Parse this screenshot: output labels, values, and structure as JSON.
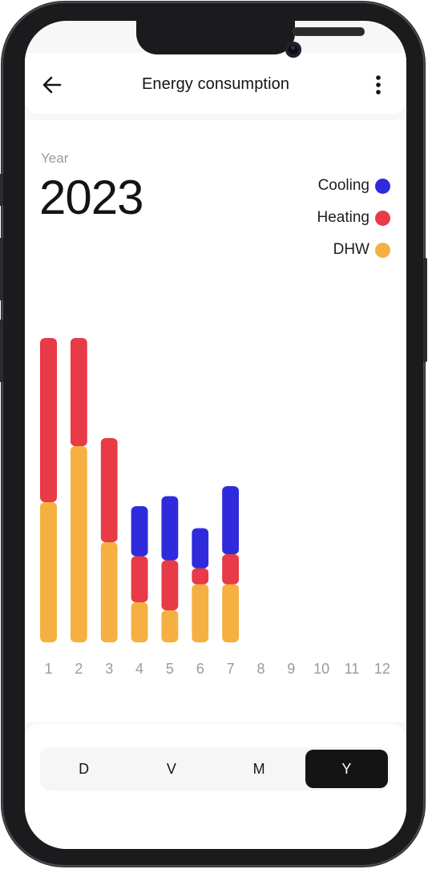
{
  "header": {
    "title": "Energy consumption",
    "back_icon": "arrow-left-icon",
    "more_icon": "more-vertical-icon"
  },
  "period": {
    "label": "Year",
    "value": "2023"
  },
  "colors": {
    "cooling": "#2f2bdc",
    "heating": "#e83a47",
    "dhw": "#f5b041",
    "tick": "#9a9a9a"
  },
  "chart_data": {
    "type": "bar",
    "stacked": true,
    "categories": [
      "1",
      "2",
      "3",
      "4",
      "5",
      "6",
      "7",
      "8",
      "9",
      "10",
      "11",
      "12"
    ],
    "series": [
      {
        "name": "DHW",
        "values": [
          35,
          49,
          25,
          10,
          8,
          14.5,
          14.5,
          0,
          0,
          0,
          0,
          0
        ]
      },
      {
        "name": "Heating",
        "values": [
          41,
          27,
          26,
          11.5,
          12.5,
          4,
          7.5,
          0,
          0,
          0,
          0,
          0
        ]
      },
      {
        "name": "Cooling",
        "values": [
          0,
          0,
          0,
          12.5,
          16,
          10,
          17,
          0,
          0,
          0,
          0,
          0
        ]
      }
    ],
    "ylim": [
      0,
      76
    ],
    "grid": false,
    "legend_position": "top-right",
    "legend_order": [
      "Cooling",
      "Heating",
      "DHW"
    ]
  },
  "view_selector": {
    "options": [
      "D",
      "V",
      "M",
      "Y"
    ],
    "selected": "Y"
  }
}
